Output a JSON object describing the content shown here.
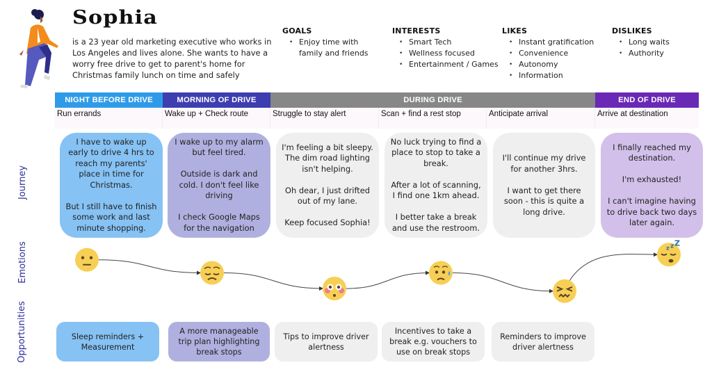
{
  "persona": {
    "name": "Sophia",
    "bio": "is a 23 year old marketing executive who works in Los Angeles and lives alone. She wants to have a worry free drive to get to parent's home for Christmas family lunch on time and safely",
    "avatar_icon": "walking-woman-illustration"
  },
  "attributes": {
    "goals": {
      "title": "GOALS",
      "items": [
        "Enjoy time with family and friends"
      ]
    },
    "interests": {
      "title": "INTERESTS",
      "items": [
        "Smart Tech",
        "Wellness focused",
        "Entertainment / Games"
      ]
    },
    "likes": {
      "title": "LIKES",
      "items": [
        "Instant gratification",
        "Convenience",
        "Autonomy",
        "Information"
      ]
    },
    "dislikes": {
      "title": "DISLIKES",
      "items": [
        "Long waits",
        "Authority"
      ]
    }
  },
  "phases": [
    {
      "label": "NIGHT BEFORE DRIVE",
      "color": "#2f9be8"
    },
    {
      "label": "MORNING OF DRIVE",
      "color": "#3d3eb0"
    },
    {
      "label": "DURING DRIVE",
      "color": "#878787"
    },
    {
      "label": "END OF DRIVE",
      "color": "#6a28b6"
    }
  ],
  "stages": [
    "Run errands",
    "Wake up + Check route",
    "Struggle to stay alert",
    "Scan + find a rest stop",
    "Anticipate arrival",
    "Arrive at destination"
  ],
  "lanes": {
    "journey": "Journey",
    "emotions": "Emotions",
    "opportunities": "Opportunities"
  },
  "journey": [
    {
      "text": "I have to wake up early to drive 4 hrs to reach my parents' place in time for Christmas.\n\nBut I still have to finish some work and last minute shopping.",
      "color": "#86c2f4"
    },
    {
      "text": "I wake up to my alarm but feel tired.\n\nOutside is dark and cold. I don't feel like driving\n\nI check Google Maps for the navigation",
      "color": "#b0b0e0"
    },
    {
      "text": "I'm feeling a bit sleepy. The dim road lighting isn't helping.\n\nOh dear, I just drifted out of my lane.\n\nKeep focused Sophia!",
      "color": "#efefef"
    },
    {
      "text": "No luck trying to find a place to stop to take a break.\n\nAfter a lot of scanning, I find one 1km ahead.\n\nI better take a break and use the restroom.",
      "color": "#efefef"
    },
    {
      "text": "I'll continue my drive for another 3hrs.\n\nI want to get there soon - this is quite a long drive.",
      "color": "#efefef"
    },
    {
      "text": "I finally reached my destination.\n\nI'm exhausted!\n\nI can't imagine having to drive back two days later again.",
      "color": "#d2c0ea"
    }
  ],
  "emotions": [
    {
      "name": "neutral-face",
      "level": 0.75
    },
    {
      "name": "pensive-face",
      "level": 0.5
    },
    {
      "name": "flushed-face",
      "level": 0.2
    },
    {
      "name": "sad-sweat-face",
      "level": 0.5
    },
    {
      "name": "confounded-face",
      "level": 0.15
    },
    {
      "name": "sleepy-face",
      "level": 0.85
    }
  ],
  "opportunities": [
    {
      "text": "Sleep reminders + Measurement",
      "color": "#86c2f4"
    },
    {
      "text": "A more manageable trip plan highlighting break stops",
      "color": "#b0b0e0"
    },
    {
      "text": "Tips to improve driver alertness",
      "color": "#efefef"
    },
    {
      "text": "Incentives to take a break e.g. vouchers to use on break stops",
      "color": "#efefef"
    },
    {
      "text": "Reminders to improve driver alertness",
      "color": "#efefef"
    }
  ]
}
